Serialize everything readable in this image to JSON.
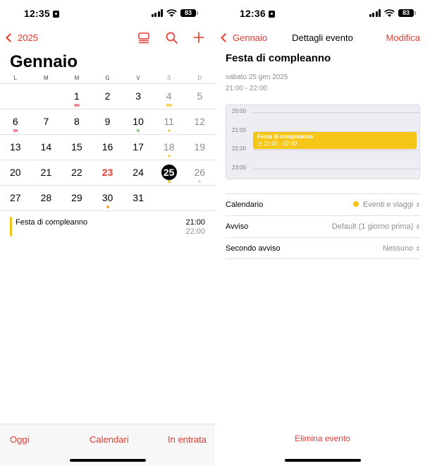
{
  "left": {
    "status": {
      "time": "12:35",
      "battery": "83"
    },
    "nav": {
      "back_label": "2025"
    },
    "month": "Gennaio",
    "weekdays": [
      "L",
      "M",
      "M",
      "G",
      "V",
      "S",
      "D"
    ],
    "weeks": [
      [
        null,
        null,
        "1",
        "2",
        "3",
        "4",
        "5"
      ],
      [
        "6",
        "7",
        "8",
        "9",
        "10",
        "11",
        "12"
      ],
      [
        "13",
        "14",
        "15",
        "16",
        "17",
        "18",
        "19"
      ],
      [
        "20",
        "21",
        "22",
        "23",
        "24",
        "25",
        "26"
      ],
      [
        "27",
        "28",
        "29",
        "30",
        "31",
        null,
        null
      ]
    ],
    "event": {
      "title": "Festa di compleanno",
      "start": "21:00",
      "end": "22:00"
    },
    "toolbar": {
      "today": "Oggi",
      "calendars": "Calendari",
      "inbox": "In entrata"
    },
    "colors": {
      "accent": "#e5392f",
      "event": "#f3c318"
    }
  },
  "right": {
    "status": {
      "time": "12:36",
      "battery": "83"
    },
    "nav": {
      "back_label": "Gennaio",
      "title": "Dettagli evento",
      "edit_label": "Modifica"
    },
    "event": {
      "title": "Festa di compleanno",
      "date": "sabato 25 gen 2025",
      "time_range": "21:00 - 22:00"
    },
    "timeline": {
      "hours": [
        "20:00",
        "21:00",
        "22:00",
        "23:00"
      ],
      "event_title": "Festa di compleanno",
      "event_time": "21:00 - 22:00"
    },
    "details": [
      {
        "key": "Calendario",
        "value": "Eventi e viaggi"
      },
      {
        "key": "Avviso",
        "value": "Default (1 giorno prima)"
      },
      {
        "key": "Secondo avviso",
        "value": "Nessuno"
      }
    ],
    "delete_label": "Elimina evento"
  }
}
